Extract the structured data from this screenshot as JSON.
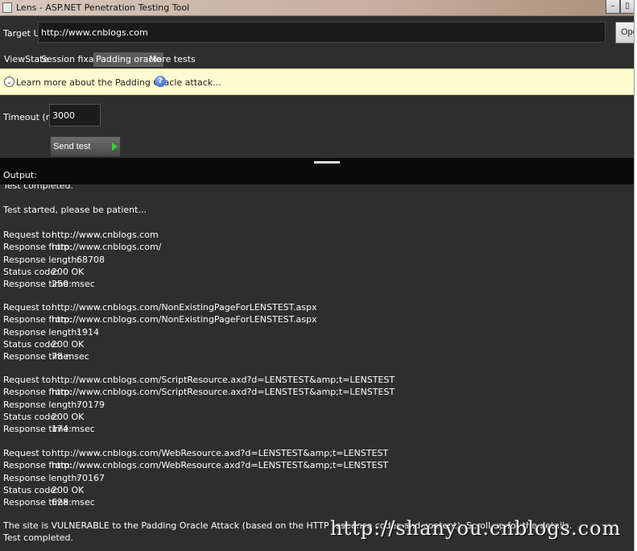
{
  "window": {
    "title": "Lens - ASP.NET Penetration Testing Tool",
    "minimize": "–",
    "maximize": "▯"
  },
  "url_bar": {
    "label": "Target URL:",
    "value": "http://www.cnblogs.com",
    "open_label": "Ope"
  },
  "tabs": [
    {
      "label": "ViewState",
      "active": false
    },
    {
      "label": "Session fixation",
      "active": false
    },
    {
      "label": "Padding oracle",
      "active": true
    },
    {
      "label": "More tests",
      "active": false
    }
  ],
  "info_bar": {
    "text": "Learn more about the Padding Oracle attack...",
    "help": "?"
  },
  "settings": {
    "timeout_label": "Timeout (ms):",
    "timeout_value": "3000",
    "send_label": "Send test requests"
  },
  "output": {
    "label": "Output:",
    "lines": {
      "prev_completed": "Test completed.",
      "started": "Test started, please be patient...",
      "vulnerable": "The site is VULNERABLE to the Padding Oracle Attack (based on the HTTP response codes and content). Scroll up for the details.",
      "completed": "Test completed."
    },
    "field_labels": {
      "request_to": "Request to:",
      "response_from": "Response from:",
      "response_length": "Response length:",
      "status_code": "Status code:",
      "response_time": "Response time:"
    },
    "requests": [
      {
        "request_to": "http://www.cnblogs.com",
        "response_from": "http://www.cnblogs.com/",
        "response_length": "68708",
        "status_code": "200 OK",
        "response_time": "250 msec"
      },
      {
        "request_to": "http://www.cnblogs.com/NonExistingPageForLENSTEST.aspx",
        "response_from": "http://www.cnblogs.com/NonExistingPageForLENSTEST.aspx",
        "response_length": "1914",
        "status_code": "200 OK",
        "response_time": "78 msec"
      },
      {
        "request_to": "http://www.cnblogs.com/ScriptResource.axd?d=LENSTEST&amp;t=LENSTEST",
        "response_from": "http://www.cnblogs.com/ScriptResource.axd?d=LENSTEST&amp;t=LENSTEST",
        "response_length": "70179",
        "status_code": "200 OK",
        "response_time": "174 msec"
      },
      {
        "request_to": "http://www.cnblogs.com/WebResource.axd?d=LENSTEST&amp;t=LENSTEST",
        "response_from": "http://www.cnblogs.com/WebResource.axd?d=LENSTEST&amp;t=LENSTEST",
        "response_length": "70167",
        "status_code": "200 OK",
        "response_time": "628 msec"
      }
    ]
  },
  "watermark": "http://shanyou.cnblogs.com"
}
